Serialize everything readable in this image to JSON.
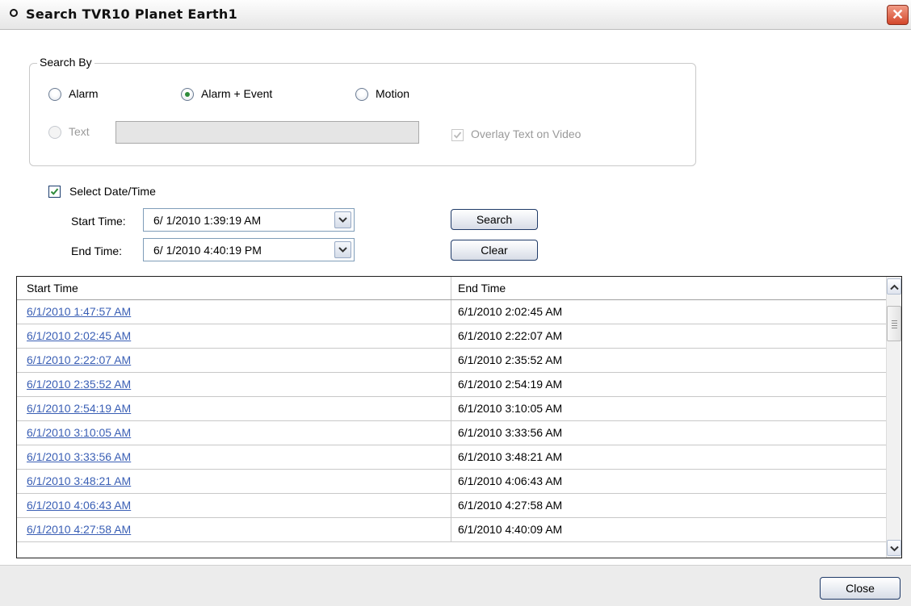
{
  "window": {
    "title": "Search  TVR10  Planet Earth1",
    "close_glyph": "✕"
  },
  "search_by": {
    "legend": "Search By",
    "options": [
      {
        "label": "Alarm",
        "checked": false,
        "enabled": true
      },
      {
        "label": "Alarm + Event",
        "checked": true,
        "enabled": true
      },
      {
        "label": "Motion",
        "checked": false,
        "enabled": true
      },
      {
        "label": "Text",
        "checked": false,
        "enabled": false
      }
    ],
    "text_value": "",
    "overlay_label": "Overlay Text on Video",
    "overlay_checked": true,
    "overlay_enabled": false
  },
  "date_time": {
    "select_label": "Select Date/Time",
    "select_checked": true,
    "start_label": "Start Time:",
    "start_value": "6/  1/2010   1:39:19 AM",
    "end_label": "End Time:",
    "end_value": "6/  1/2010   4:40:19 PM"
  },
  "buttons": {
    "search": "Search",
    "clear": "Clear",
    "close": "Close"
  },
  "results": {
    "columns": [
      "Start Time",
      "End Time"
    ],
    "rows": [
      [
        "6/1/2010 1:47:57 AM",
        "6/1/2010 2:02:45 AM"
      ],
      [
        "6/1/2010 2:02:45 AM",
        "6/1/2010 2:22:07 AM"
      ],
      [
        "6/1/2010 2:22:07 AM",
        "6/1/2010 2:35:52 AM"
      ],
      [
        "6/1/2010 2:35:52 AM",
        "6/1/2010 2:54:19 AM"
      ],
      [
        "6/1/2010 2:54:19 AM",
        "6/1/2010 3:10:05 AM"
      ],
      [
        "6/1/2010 3:10:05 AM",
        "6/1/2010 3:33:56 AM"
      ],
      [
        "6/1/2010 3:33:56 AM",
        "6/1/2010 3:48:21 AM"
      ],
      [
        "6/1/2010 3:48:21 AM",
        "6/1/2010 4:06:43 AM"
      ],
      [
        "6/1/2010 4:06:43 AM",
        "6/1/2010 4:27:58 AM"
      ],
      [
        "6/1/2010 4:27:58 AM",
        "6/1/2010 4:40:09 AM"
      ]
    ]
  },
  "colors": {
    "link": "#3a5fb5",
    "radio_dot": "#2e8b3a",
    "close_button": "#d3472b"
  }
}
